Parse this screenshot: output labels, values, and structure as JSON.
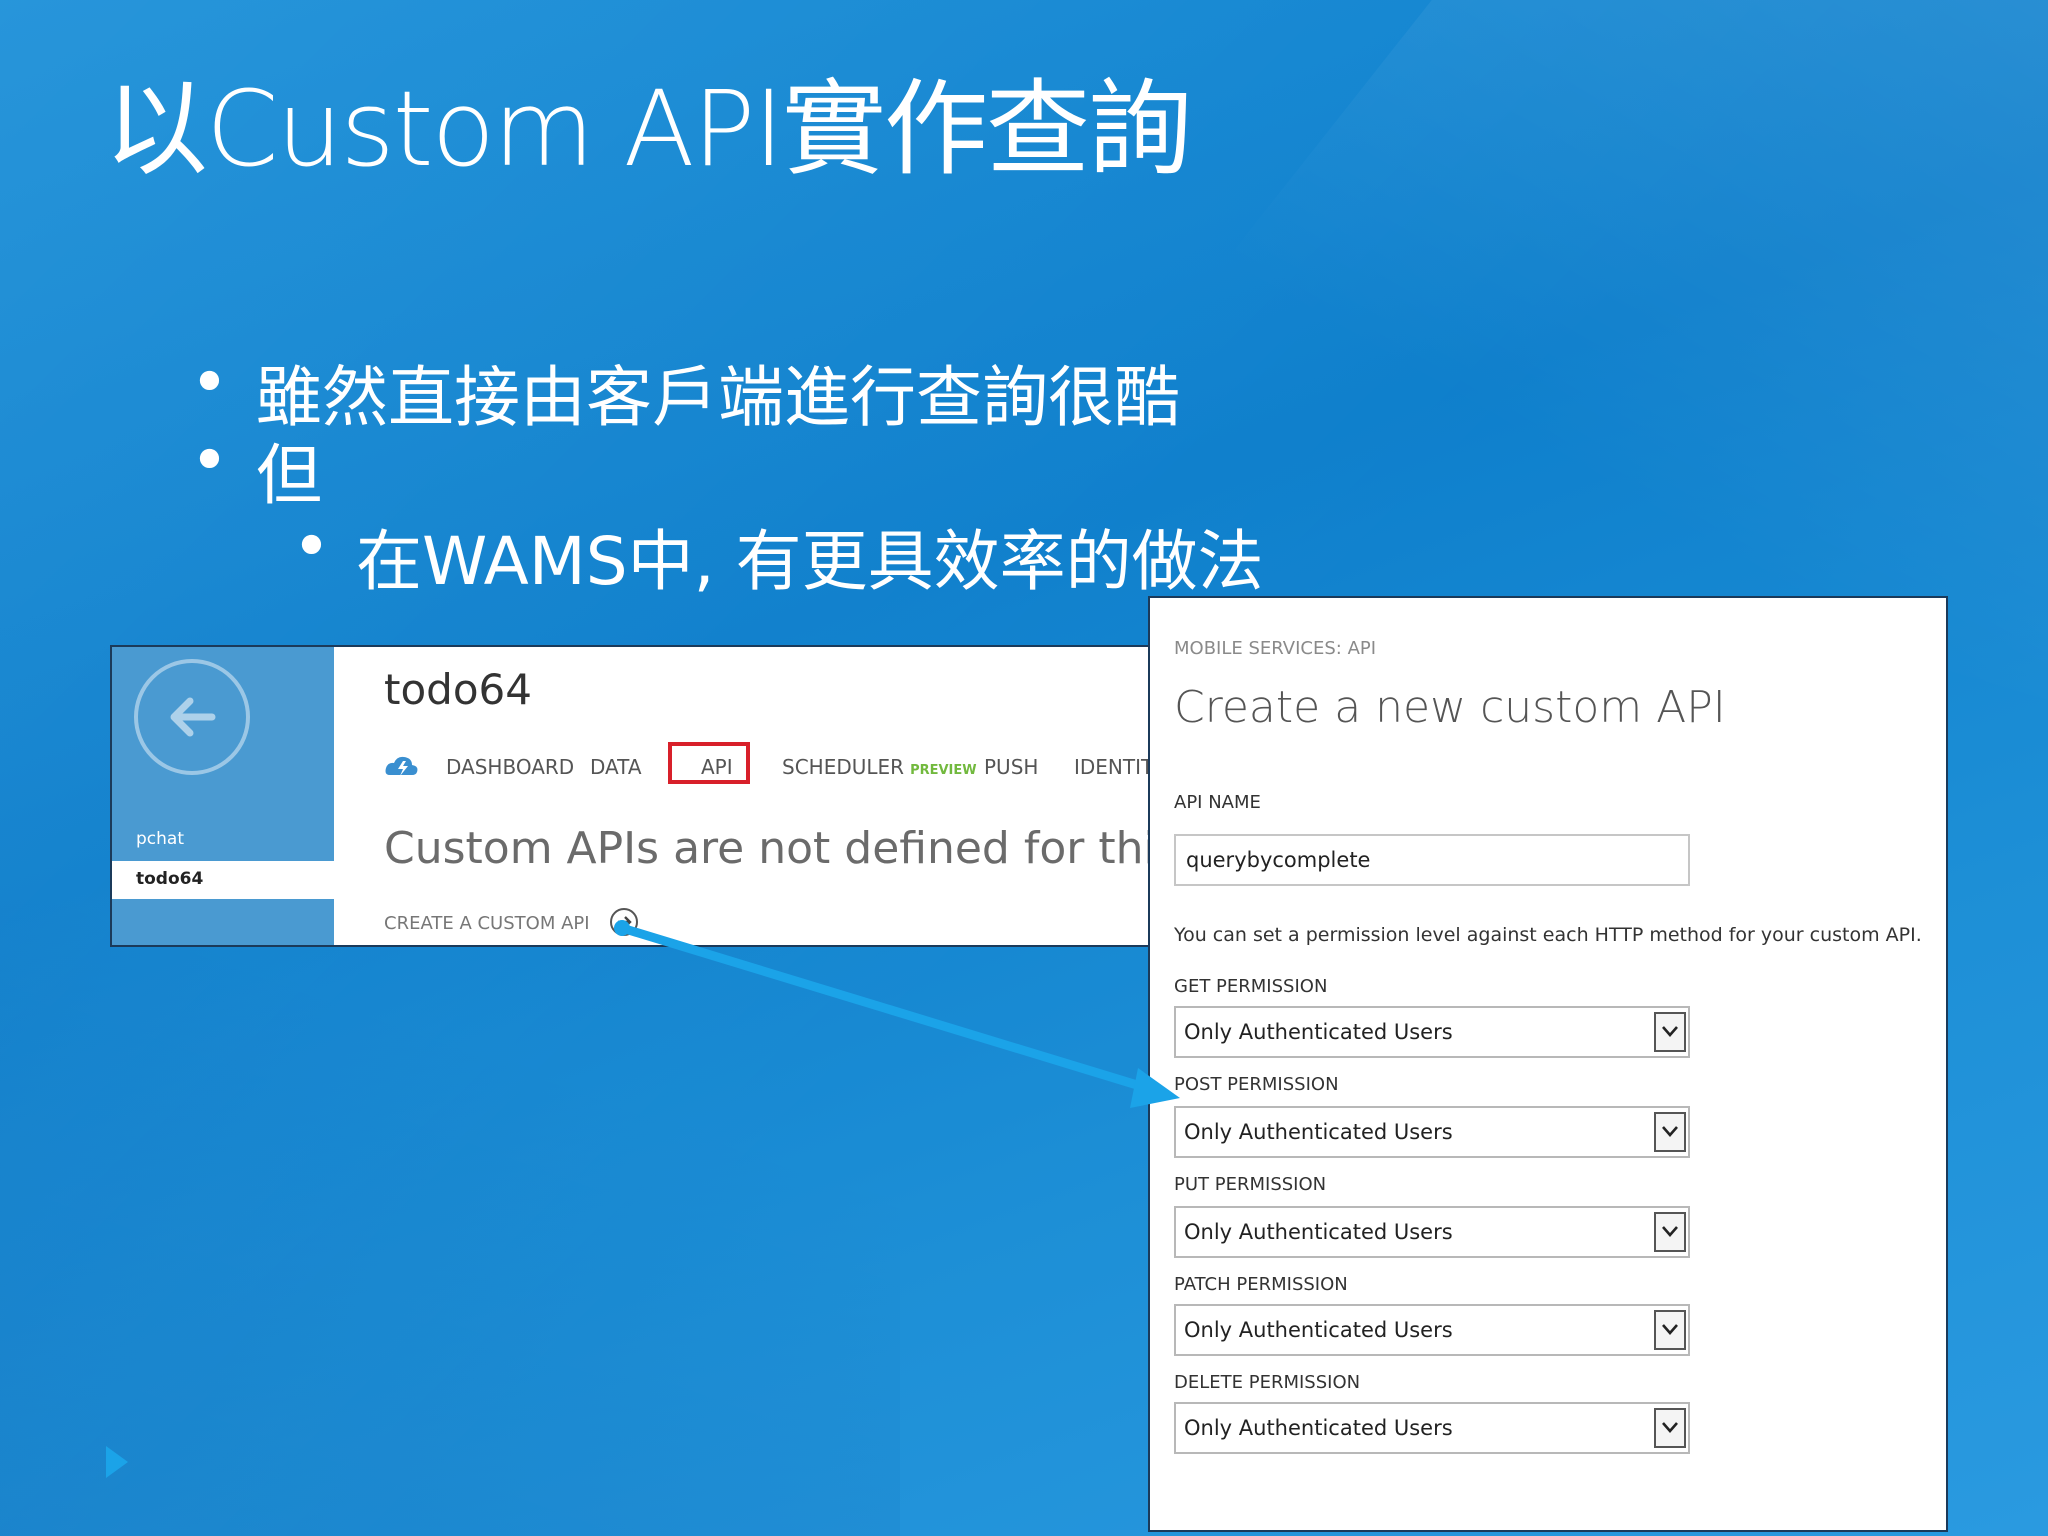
{
  "slide": {
    "title": "以Custom API實作查詢",
    "bullets": [
      {
        "mark": "•",
        "text": "雖然直接由客戶端進行查詢很酷"
      },
      {
        "mark": "•",
        "text": "但"
      },
      {
        "mark": "•",
        "text": "在WAMS中, 有更具效率的做法"
      }
    ]
  },
  "portal": {
    "sidebar": {
      "items": [
        "pchat",
        "todo64"
      ],
      "selected": "todo64"
    },
    "service_name": "todo64",
    "nav": [
      {
        "label": "DASHBOARD"
      },
      {
        "label": "DATA"
      },
      {
        "label": "API"
      },
      {
        "label": "SCHEDULER",
        "badge": "PREVIEW"
      },
      {
        "label": "PUSH"
      },
      {
        "label": "IDENTITY"
      }
    ],
    "message": "Custom APIs are not defined for this mo",
    "create_link": "CREATE A CUSTOM API"
  },
  "dialog": {
    "breadcrumb": "MOBILE SERVICES: API",
    "title": "Create a new custom API",
    "api_name_label": "API NAME",
    "api_name_value": "querybycomplete",
    "hint": "You can set a permission level against each HTTP method for your custom API.",
    "permissions": [
      {
        "label": "GET PERMISSION",
        "value": "Only Authenticated Users"
      },
      {
        "label": "POST PERMISSION",
        "value": "Only Authenticated Users"
      },
      {
        "label": "PUT PERMISSION",
        "value": "Only Authenticated Users"
      },
      {
        "label": "PATCH PERMISSION",
        "value": "Only Authenticated Users"
      },
      {
        "label": "DELETE PERMISSION",
        "value": "Only Authenticated Users"
      }
    ]
  },
  "colors": {
    "background": "#1186d4",
    "portal_sidebar": "#4a9ad1",
    "highlight_box": "#d8202a",
    "preview_badge": "#72b93e",
    "arrow": "#1ba3e8"
  }
}
